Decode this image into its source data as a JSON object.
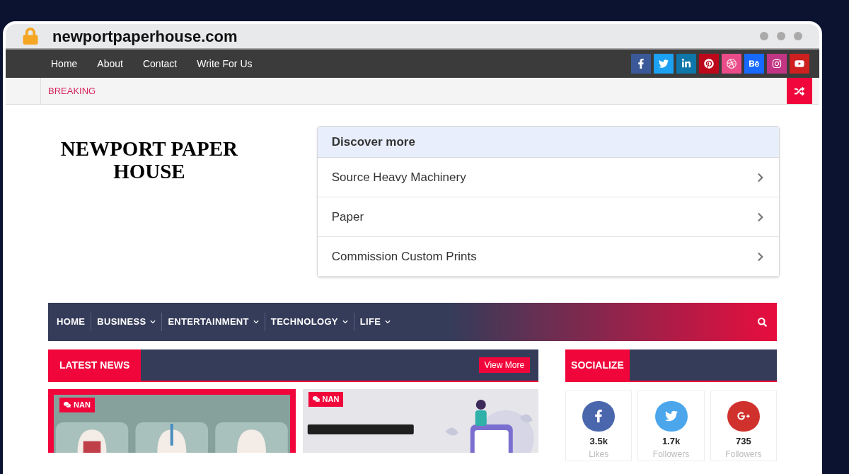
{
  "browser": {
    "url": "newportpaperhouse.com"
  },
  "top_nav": {
    "links": [
      "Home",
      "About",
      "Contact",
      "Write For Us"
    ],
    "social": [
      {
        "kind": "facebook",
        "color": "#3b5998"
      },
      {
        "kind": "twitter",
        "color": "#1da1f2"
      },
      {
        "kind": "linkedin",
        "color": "#0e76a8"
      },
      {
        "kind": "pinterest",
        "color": "#bd081c"
      },
      {
        "kind": "dribbble",
        "color": "#ea4c89"
      },
      {
        "kind": "behance",
        "color": "#1769ff"
      },
      {
        "kind": "instagram",
        "color": "#c13584"
      },
      {
        "kind": "youtube",
        "color": "#cd201f"
      }
    ]
  },
  "breaking": {
    "label": "BREAKING"
  },
  "logo": {
    "line1": "NEWPORT PAPER",
    "line2": "HOUSE"
  },
  "discover": {
    "title": "Discover more",
    "items": [
      "Source Heavy Machinery",
      "Paper",
      "Commission Custom Prints"
    ]
  },
  "main_nav": [
    {
      "label": "HOME",
      "dropdown": false
    },
    {
      "label": "BUSINESS",
      "dropdown": true
    },
    {
      "label": "ENTERTAINMENT",
      "dropdown": true
    },
    {
      "label": "TECHNOLOGY",
      "dropdown": true
    },
    {
      "label": "LIFE",
      "dropdown": true
    }
  ],
  "latest_news": {
    "title": "LATEST NEWS",
    "button": "View More",
    "cards": [
      {
        "badge": "NAN",
        "highlighted": true,
        "kind": "picture"
      },
      {
        "badge": "NAN",
        "highlighted": false,
        "kind": "picture"
      }
    ]
  },
  "socialize": {
    "title": "SOCIALIZE",
    "stats": [
      {
        "kind": "facebook",
        "color": "#4a67ad",
        "count": "3.5k",
        "label": "Likes"
      },
      {
        "kind": "twitter",
        "color": "#4ba6ec",
        "count": "1.7k",
        "label": "Followers"
      },
      {
        "kind": "googleplus",
        "color": "#d0312d",
        "count": "735",
        "label": "Followers"
      }
    ]
  }
}
